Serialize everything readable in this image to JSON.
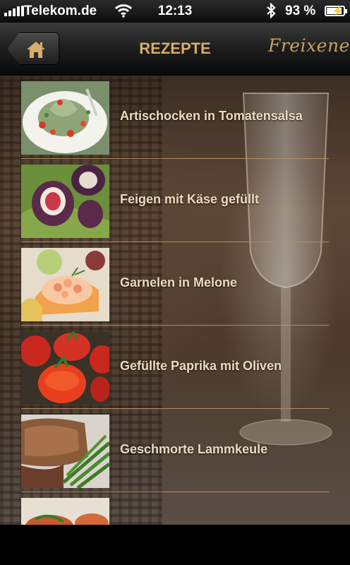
{
  "status_bar": {
    "carrier": "Telekom.de",
    "time": "12:13",
    "battery_percent": "93 %",
    "battery_level": 0.93,
    "icons": [
      "signal-icon",
      "wifi-icon",
      "bluetooth-icon",
      "battery-icon"
    ]
  },
  "nav_bar": {
    "title": "REZEPTE",
    "home_icon": "home-icon",
    "brand": "Freixenet"
  },
  "recipes": [
    {
      "name": "Artischocken in Tomatensalsa"
    },
    {
      "name": "Feigen mit Käse gefüllt"
    },
    {
      "name": "Garnelen in Melone"
    },
    {
      "name": "Gefüllte Paprika mit Oliven"
    },
    {
      "name": "Geschmorte Lammkeule"
    },
    {
      "name": ""
    }
  ],
  "colors": {
    "title_gold": "#d8ad6a",
    "row_text": "#ecdcbf",
    "divider": "#b29061"
  }
}
